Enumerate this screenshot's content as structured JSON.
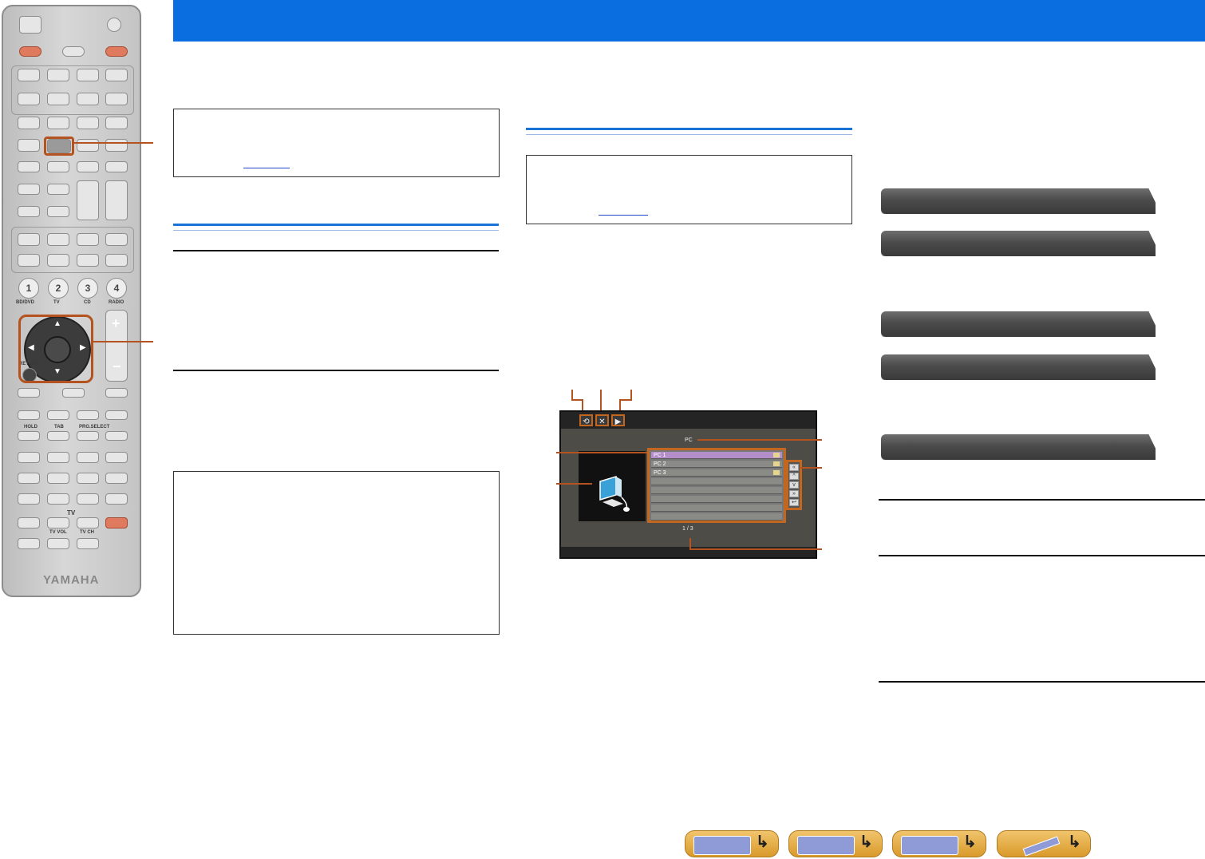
{
  "colors": {
    "header": "#0a6ee0",
    "accent": "#b4531f",
    "tab": "#4b4b4b"
  },
  "remote": {
    "input_buttons": [
      "1",
      "2",
      "3",
      "4"
    ],
    "input_labels": [
      "BD/DVD",
      "TV",
      "CD",
      "RADIO"
    ],
    "return_label": "RETURN",
    "transport_labels": [
      "HOLD",
      "TAB",
      "PRG.SELECT"
    ],
    "tv_label": "TV",
    "tv_vol_label": "TV VOL",
    "tv_ch_label": "TV CH",
    "logo": "YAMAHA"
  },
  "screen": {
    "title": "PC",
    "items": [
      "PC 1",
      "PC 2",
      "PC 3"
    ],
    "page": "1 / 3",
    "icons": [
      "repeat-icon",
      "shuffle-icon",
      "play-icon"
    ],
    "nav_buttons": [
      "«",
      "^",
      "v",
      "»",
      "↩"
    ]
  },
  "footer": {
    "buttons": [
      "front-panel-icon",
      "rear-panel-icon",
      "display-icon",
      "remote-icon"
    ]
  }
}
